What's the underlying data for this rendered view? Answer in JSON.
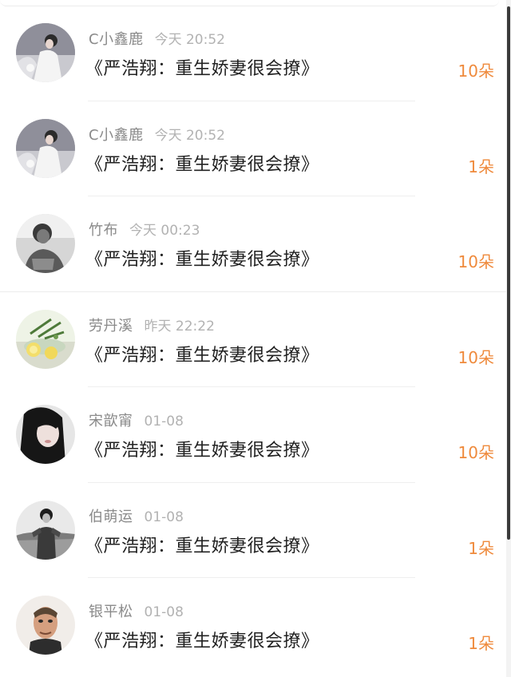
{
  "gifts": [
    {
      "sender": "C小鑫鹿",
      "time": "今天 20:52",
      "title": "《严浩翔：重生娇妻很会撩》",
      "count": "10朵",
      "avatar_icon": "woman-white-dress-avatar"
    },
    {
      "sender": "C小鑫鹿",
      "time": "今天 20:52",
      "title": "《严浩翔：重生娇妻很会撩》",
      "count": "1朵",
      "avatar_icon": "woman-white-dress-avatar"
    },
    {
      "sender": "竹布",
      "time": "今天 00:23",
      "title": "《严浩翔：重生娇妻很会撩》",
      "count": "10朵",
      "avatar_icon": "grayscale-person-avatar"
    },
    {
      "sender": "劳丹溪",
      "time": "昨天 22:22",
      "title": "《严浩翔：重生娇妻很会撩》",
      "count": "10朵",
      "avatar_icon": "lemon-drink-avatar"
    },
    {
      "sender": "宋歆甯",
      "time": "01-08",
      "title": "《严浩翔：重生娇妻很会撩》",
      "count": "10朵",
      "avatar_icon": "girl-portrait-avatar"
    },
    {
      "sender": "伯萌运",
      "time": "01-08",
      "title": "《严浩翔：重生娇妻很会撩》",
      "count": "1朵",
      "avatar_icon": "bw-man-field-avatar"
    },
    {
      "sender": "银平松",
      "time": "01-08",
      "title": "《严浩翔：重生娇妻很会撩》",
      "count": "1朵",
      "avatar_icon": "cartoon-man-avatar"
    }
  ],
  "colors": {
    "count_accent": "#ef8a3c",
    "sender_text": "#8a8a8a",
    "time_text": "#b2b2b2",
    "title_text": "#222222"
  }
}
